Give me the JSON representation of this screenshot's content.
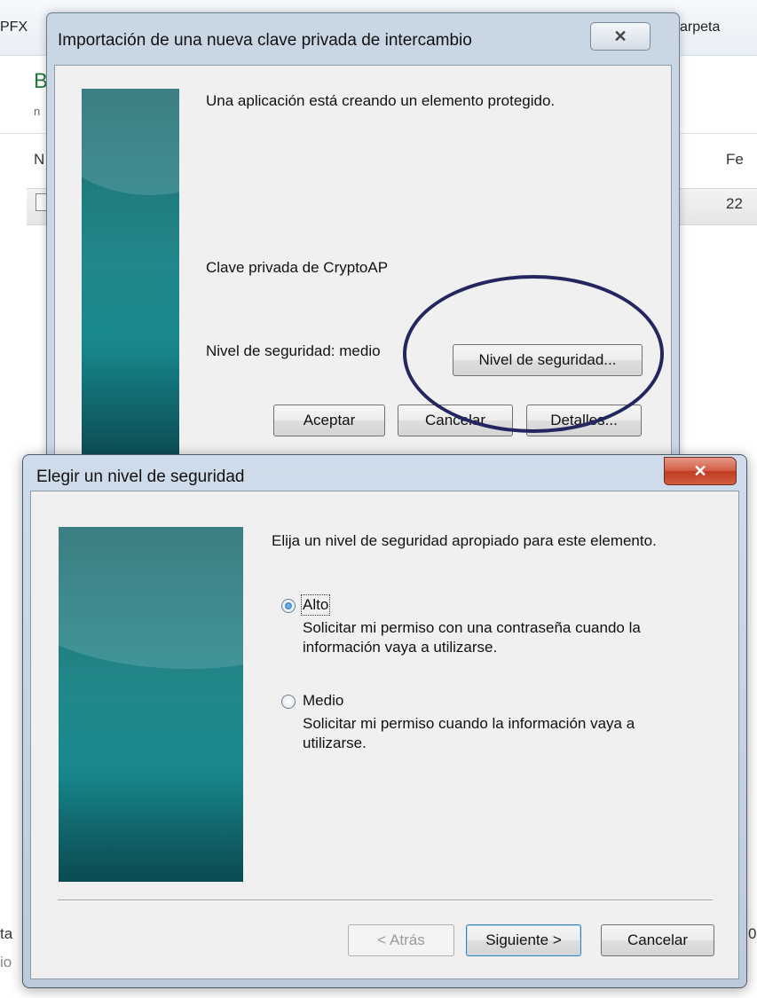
{
  "background_window": {
    "crumb_left": "PFX",
    "crumb_right": "arpeta",
    "heading_fragment": "B",
    "sub_fragment": "n",
    "column_name_fragment": "N",
    "column_date_fragment": "Fe",
    "row_date_fragment": "22",
    "status_left_fragment": "ta",
    "status_left2_fragment": "io",
    "status_right_fragment": "0"
  },
  "dialog_import": {
    "title": "Importación de una nueva clave privada de intercambio",
    "close_label": "✕",
    "message": "Una aplicación está creando un elemento protegido.",
    "key_name": "Clave privada de CryptoAP",
    "security_level": "Nivel de seguridad: medio",
    "security_button": "Nivel de seguridad...",
    "ok_button": "Aceptar",
    "cancel_button": "Cancelar",
    "details_button": "Detalles..."
  },
  "dialog_level": {
    "title": "Elegir un nivel de seguridad",
    "close_label": "✕",
    "instruction": "Elija un nivel de seguridad apropiado para este elemento.",
    "options": [
      {
        "label": "Alto",
        "desc_line1": "Solicitar mi permiso con una contraseña cuando la",
        "desc_line2": "información vaya a utilizarse.",
        "selected": true
      },
      {
        "label": "Medio",
        "desc_line1": "Solicitar mi permiso cuando la información vaya a",
        "desc_line2": "utilizarse.",
        "selected": false
      }
    ],
    "back_button": "< Atrás",
    "next_button": "Siguiente >",
    "cancel_button": "Cancelar"
  },
  "colors": {
    "annotation_oval": "#24275f",
    "banner_teal": "#1d7a7e",
    "close_red": "#c03b23"
  }
}
